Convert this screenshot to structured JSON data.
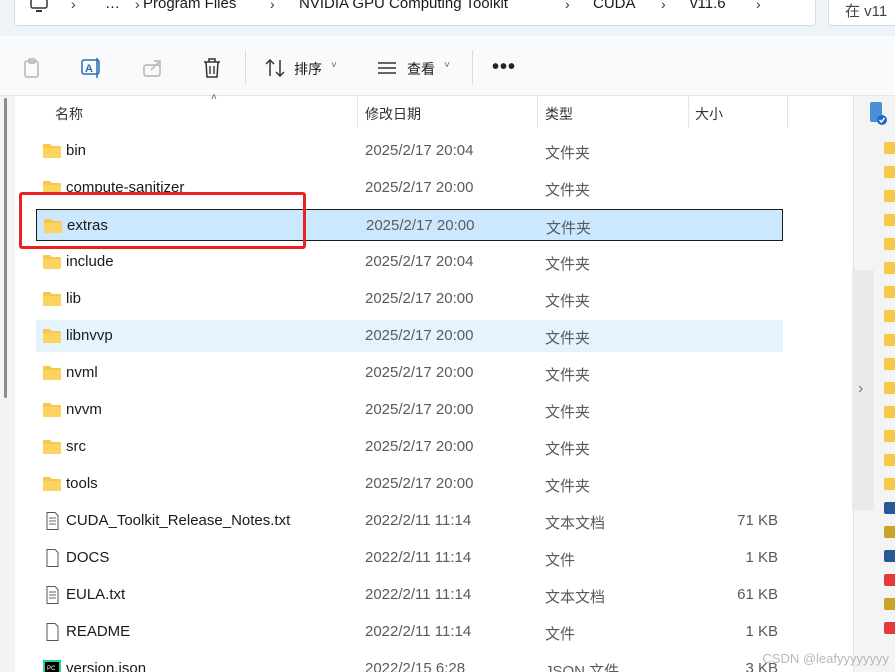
{
  "address": {
    "crumbs": [
      "Program Files",
      "NVIDIA GPU Computing Toolkit",
      "CUDA",
      "v11.6"
    ],
    "ellipsis": "…",
    "separator": "›",
    "search_text": "在 v11"
  },
  "toolbar": {
    "sort_label": "排序",
    "view_label": "查看",
    "more_label": "•••",
    "caret": "˅"
  },
  "columns": {
    "name": "名称",
    "date": "修改日期",
    "type": "类型",
    "size": "大小",
    "sort_indicator": "˄"
  },
  "files": [
    {
      "name": "bin",
      "date": "2025/2/17 20:04",
      "type": "文件夹",
      "size": "",
      "icon": "folder-icon"
    },
    {
      "name": "compute-sanitizer",
      "date": "2025/2/17 20:00",
      "type": "文件夹",
      "size": "",
      "icon": "folder-icon"
    },
    {
      "name": "extras",
      "date": "2025/2/17 20:00",
      "type": "文件夹",
      "size": "",
      "icon": "folder-icon",
      "state": "selected"
    },
    {
      "name": "include",
      "date": "2025/2/17 20:04",
      "type": "文件夹",
      "size": "",
      "icon": "folder-icon"
    },
    {
      "name": "lib",
      "date": "2025/2/17 20:00",
      "type": "文件夹",
      "size": "",
      "icon": "folder-icon"
    },
    {
      "name": "libnvvp",
      "date": "2025/2/17 20:00",
      "type": "文件夹",
      "size": "",
      "icon": "folder-icon",
      "state": "hover"
    },
    {
      "name": "nvml",
      "date": "2025/2/17 20:00",
      "type": "文件夹",
      "size": "",
      "icon": "folder-icon"
    },
    {
      "name": "nvvm",
      "date": "2025/2/17 20:00",
      "type": "文件夹",
      "size": "",
      "icon": "folder-icon"
    },
    {
      "name": "src",
      "date": "2025/2/17 20:00",
      "type": "文件夹",
      "size": "",
      "icon": "folder-icon"
    },
    {
      "name": "tools",
      "date": "2025/2/17 20:00",
      "type": "文件夹",
      "size": "",
      "icon": "folder-icon"
    },
    {
      "name": "CUDA_Toolkit_Release_Notes.txt",
      "date": "2022/2/11 11:14",
      "type": "文本文档",
      "size": "71 KB",
      "icon": "text-file-icon"
    },
    {
      "name": "DOCS",
      "date": "2022/2/11 11:14",
      "type": "文件",
      "size": "1 KB",
      "icon": "blank-file-icon"
    },
    {
      "name": "EULA.txt",
      "date": "2022/2/11 11:14",
      "type": "文本文档",
      "size": "61 KB",
      "icon": "text-file-icon"
    },
    {
      "name": "README",
      "date": "2022/2/11 11:14",
      "type": "文件",
      "size": "1 KB",
      "icon": "blank-file-icon"
    },
    {
      "name": "version.json",
      "date": "2022/2/15 6:28",
      "type": "JSON 文件",
      "size": "3 KB",
      "icon": "pycharm-file-icon"
    }
  ],
  "watermark": "CSDN @leafyyyyyyyy",
  "colors": {
    "selected_bg": "#cce8ff",
    "hover_bg": "#e5f3ff",
    "annotation_red": "#e8231f",
    "folder_yellow": "#f8c84a"
  }
}
